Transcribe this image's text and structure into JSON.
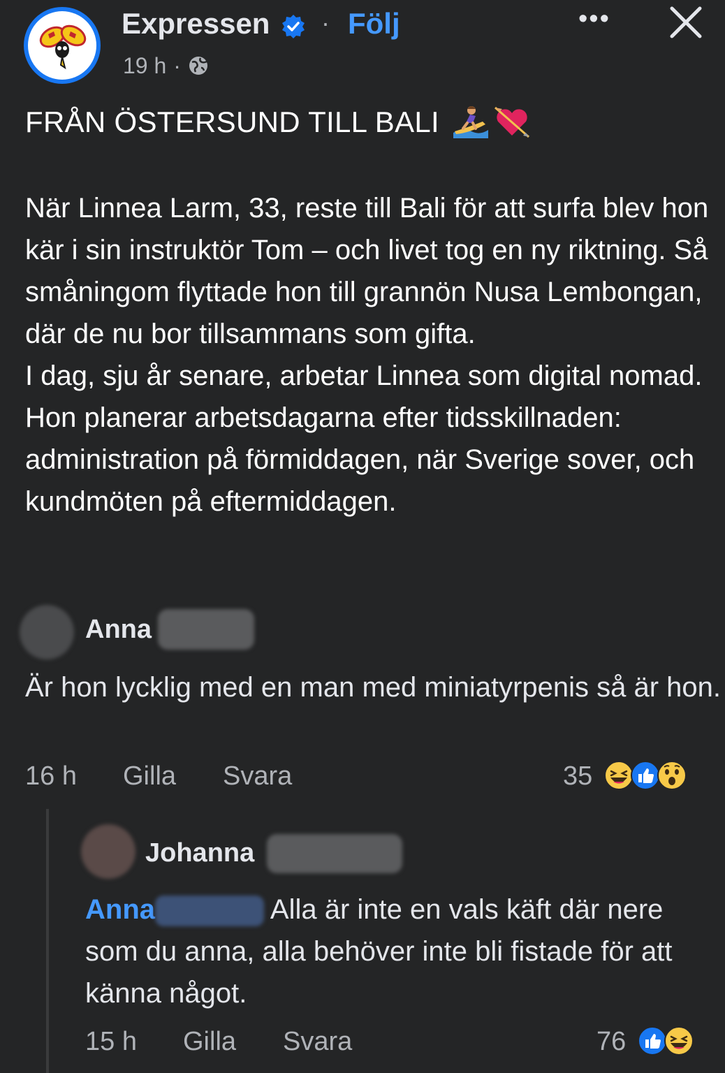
{
  "post": {
    "page_name": "Expressen",
    "follow_label": "Följ",
    "separator": "·",
    "time": "19 h",
    "time_separator": "·",
    "more_label": "•••",
    "headline": "FRÅN ÖSTERSUND TILL BALI",
    "headline_emojis": [
      "surfer-emoji",
      "heart-with-arrow-emoji"
    ],
    "paragraph1": "När Linnea Larm, 33, reste till Bali för att surfa blev hon kär i sin instruktör Tom – och livet tog en ny riktning. Så småningom flyttade hon till grannön Nusa Lembongan, där de nu bor tillsammans som gifta.",
    "paragraph2": "I dag, sju år senare, arbetar Linnea som digital nomad. Hon planerar arbetsdagarna efter tidsskillnaden: administration på förmiddagen, när Sverige sover, och kundmöten på eftermiddagen."
  },
  "comment1": {
    "author": "Anna",
    "text": "Är hon lycklig med en man med miniatyrpenis så är hon.",
    "time": "16 h",
    "like_label": "Gilla",
    "reply_label": "Svara",
    "reaction_count": "35",
    "reactions": [
      "haha",
      "like",
      "wow"
    ]
  },
  "reply1": {
    "author": "Johanna",
    "mention": "Anna",
    "text": " Alla är inte en vals käft där nere som du anna, alla behöver inte bli fistade för att känna något.",
    "time": "15 h",
    "like_label": "Gilla",
    "reply_label": "Svara",
    "reaction_count": "76",
    "reactions": [
      "like",
      "haha"
    ]
  },
  "colors": {
    "background": "#242526",
    "text": "#e4e6eb",
    "secondary": "#b0b3b8",
    "link": "#4599ff",
    "verified": "#1877f2"
  }
}
